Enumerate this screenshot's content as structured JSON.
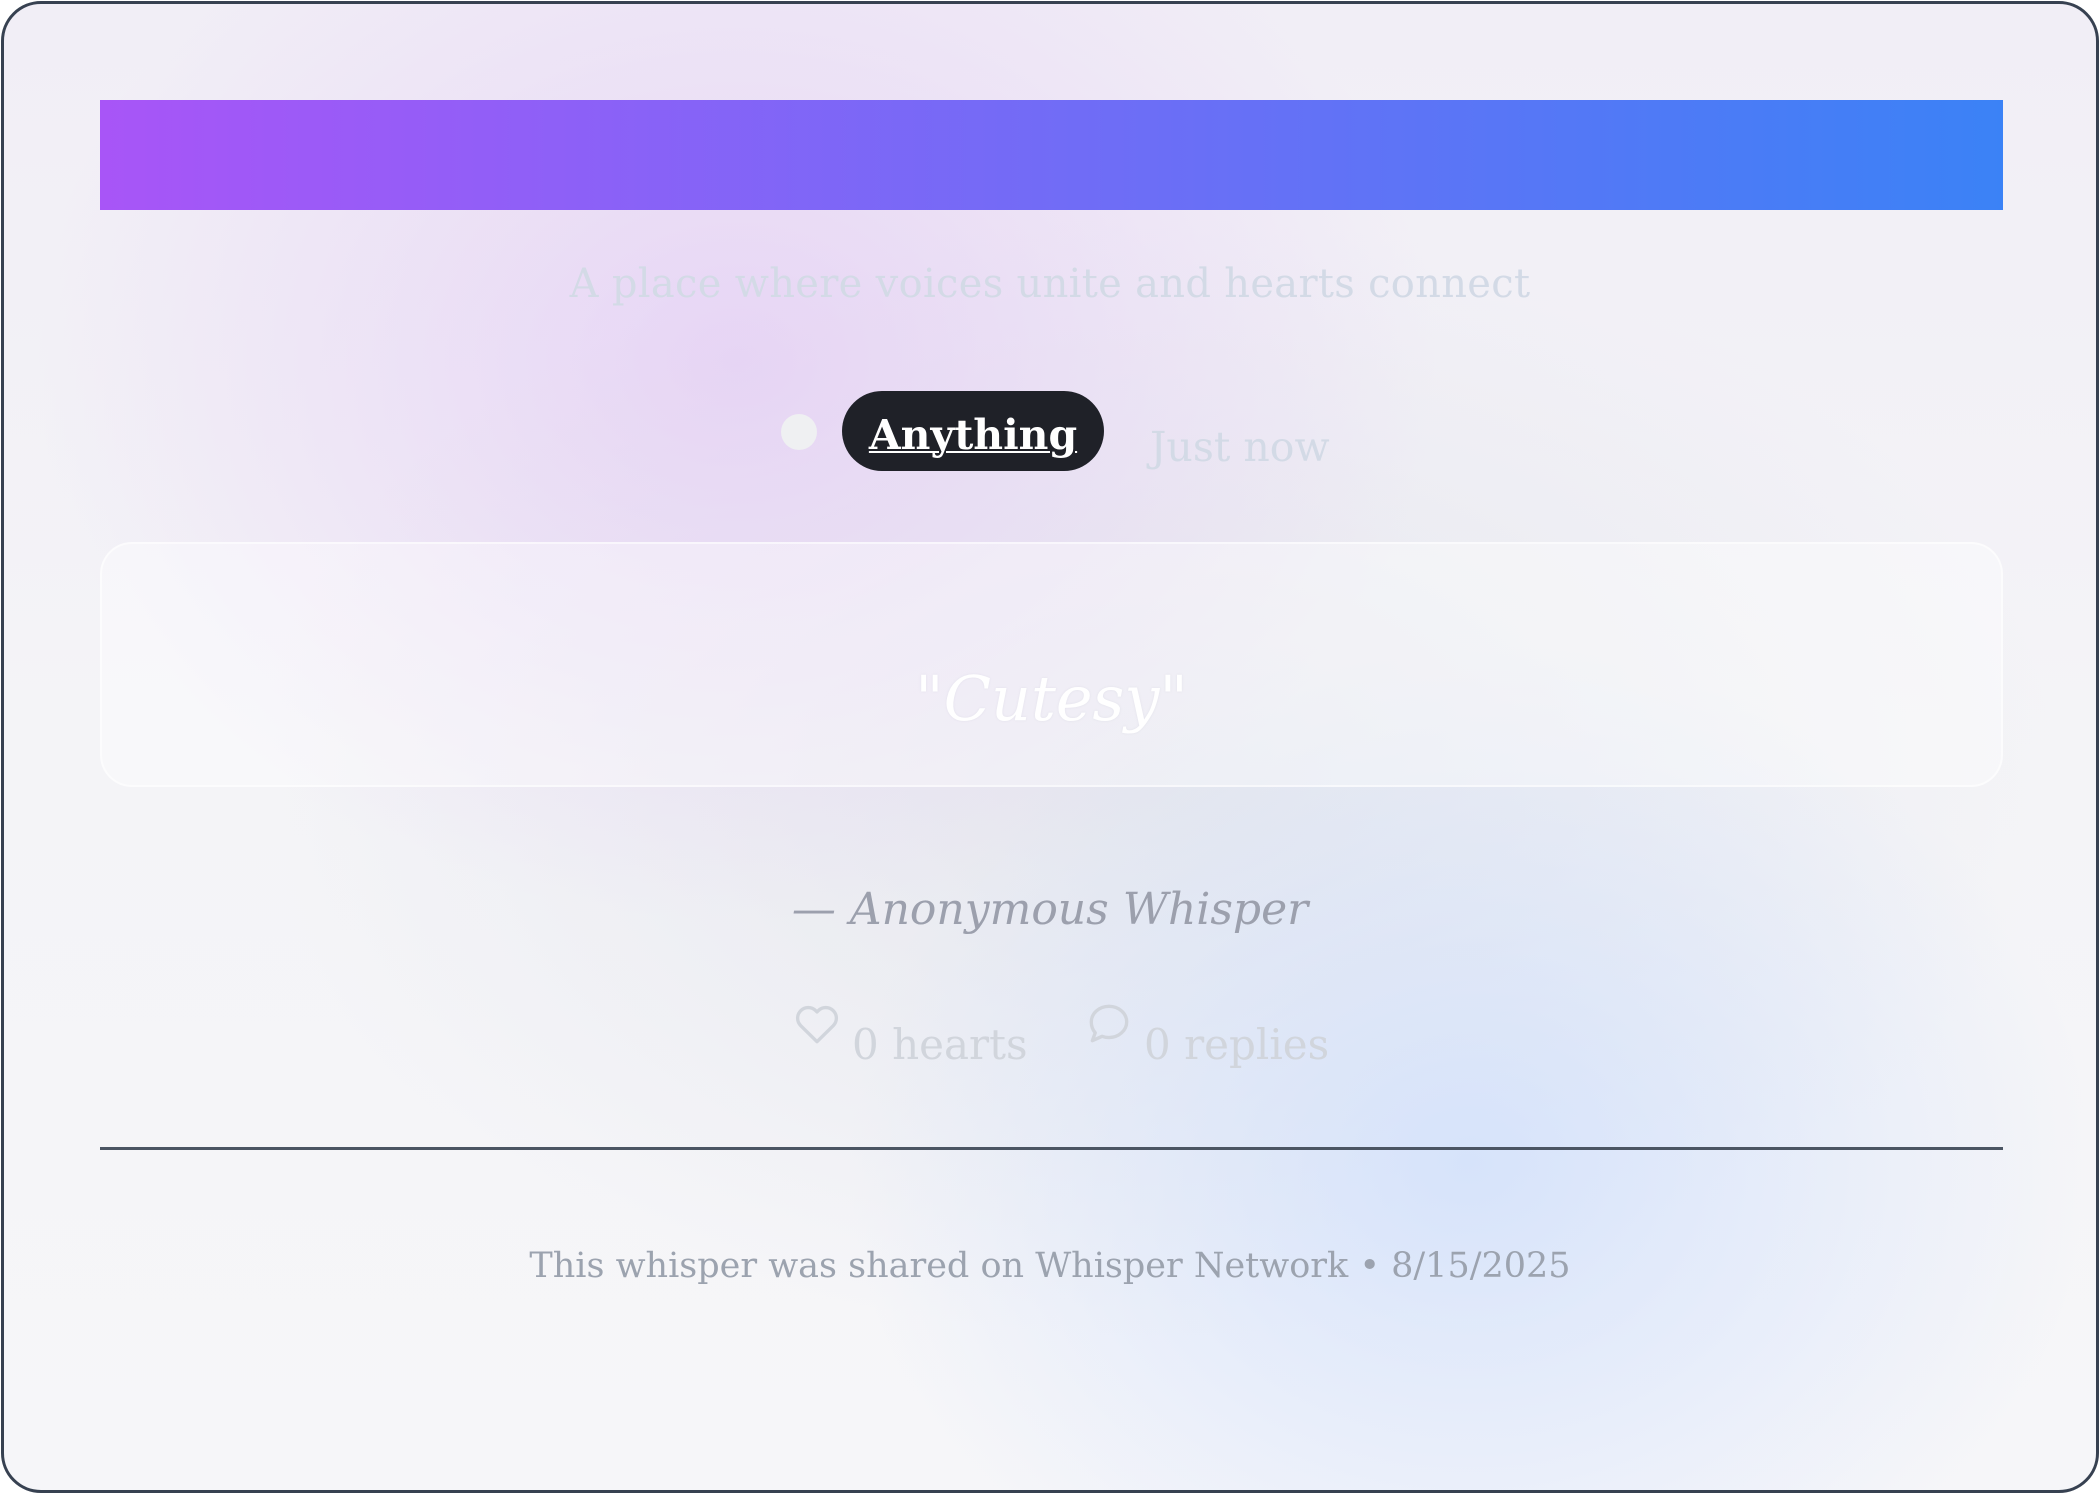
{
  "header": {
    "banner_colors": [
      "#a855f7",
      "#3b82f6"
    ],
    "tagline": "A place where voices unite and hearts connect"
  },
  "meta": {
    "category": "Anything",
    "time": "Just now"
  },
  "whisper": {
    "quote": "\"Cutesy\"",
    "author": "— Anonymous Whisper"
  },
  "stats": {
    "hearts_label": "0 hearts",
    "replies_label": "0 replies",
    "hearts_icon": "heart-icon",
    "replies_icon": "speech-bubble-icon"
  },
  "footer": {
    "note": "This whisper was shared on Whisper Network • 8/15/2025"
  },
  "colors": {
    "border": "#374151",
    "pill_bg": "#1f2128",
    "divider": "#4b5563",
    "muted_text": "#9ca3af"
  }
}
